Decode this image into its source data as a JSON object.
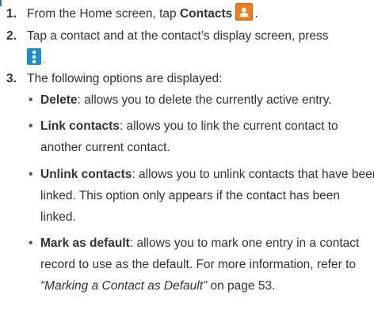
{
  "steps": [
    {
      "number": "1.",
      "text_before": "From the Home screen, tap",
      "bold": "Contacts",
      "text_after": "."
    },
    {
      "number": "2.",
      "line1": "Tap a contact and at the contact’s display screen, press",
      "after_icon": "."
    },
    {
      "number": "3.",
      "text": "The following options are displayed:"
    }
  ],
  "options": [
    {
      "term": "Delete",
      "lines": [
        ": allows you to delete the currently active entry."
      ]
    },
    {
      "term": "Link contacts",
      "lines": [
        ": allows you to link the current contact to",
        "another current contact."
      ]
    },
    {
      "term": "Unlink contacts",
      "lines": [
        ": allows you to unlink contacts that have been",
        "linked. This option only appears if the contact has been",
        "linked."
      ]
    },
    {
      "term": "Mark as default",
      "lines": [
        ": allows you to mark one entry in a contact",
        "record to use as the default. For more information, refer to"
      ],
      "ref_italic": "“Marking a Contact as Default”",
      "ref_after": " on page 53."
    }
  ],
  "icons": {
    "contacts": "contacts-app-icon",
    "menu": "menu-key-icon"
  },
  "colors": {
    "contacts_icon": "#f07a1c",
    "menu_icon": "#1a8fd0",
    "accent_mark": "#1f6fb2"
  }
}
